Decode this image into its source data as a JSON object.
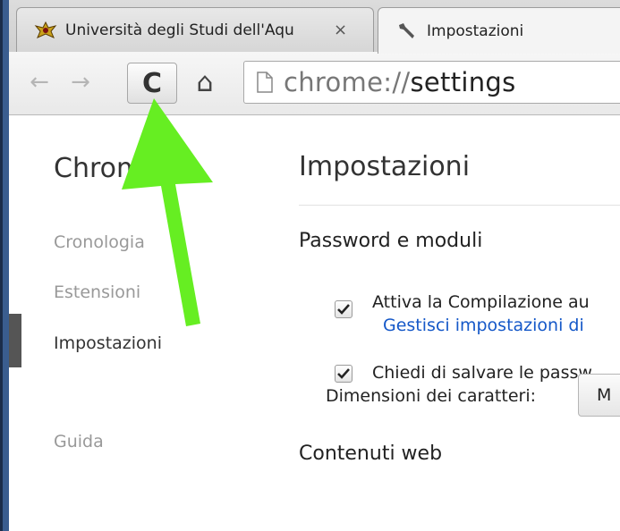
{
  "tabs": [
    {
      "title": "Università degli Studi dell'Aqu",
      "close": "×",
      "icon": "university-crest-icon"
    },
    {
      "title": "Impostazioni",
      "icon": "wrench-icon"
    }
  ],
  "toolbar": {
    "back": "←",
    "forward": "→",
    "reload": "C",
    "home": "⌂",
    "url_scheme": "chrome://",
    "url_path": "settings"
  },
  "sidebar": {
    "title": "Chrome",
    "items": [
      {
        "label": "Cronologia"
      },
      {
        "label": "Estensioni"
      },
      {
        "label": "Impostazioni"
      },
      {
        "label": "Guida"
      }
    ]
  },
  "main": {
    "title": "Impostazioni",
    "passwords_section": {
      "title": "Password e moduli",
      "autofill_label": "Attiva la Compilazione au",
      "autofill_link": "Gestisci impostazioni di",
      "save_passwords_label": "Chiedi di salvare le passw"
    },
    "web_content_section": {
      "title": "Contenuti web",
      "font_size_label": "Dimensioni dei caratteri:",
      "font_size_value": "M"
    }
  },
  "colors": {
    "annotation_arrow": "#66ee22",
    "link": "#1558c8"
  }
}
